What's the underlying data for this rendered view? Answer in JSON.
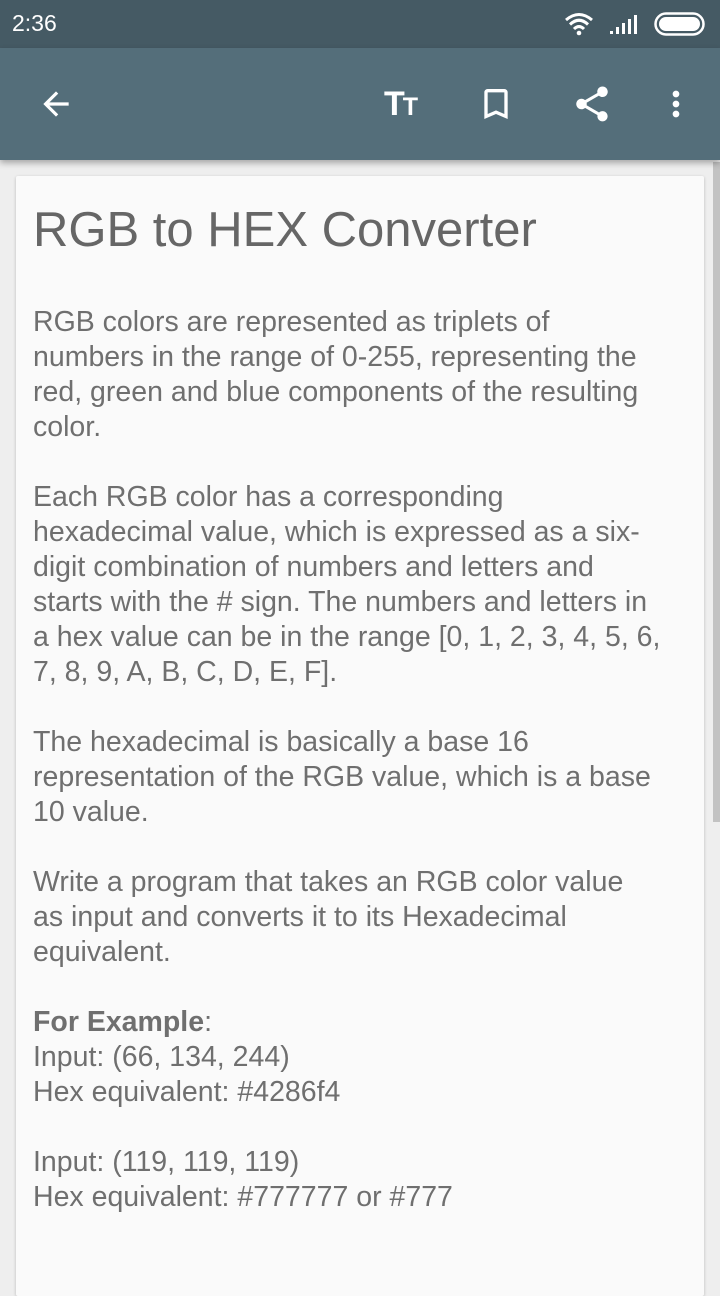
{
  "status_bar": {
    "time": "2:36"
  },
  "toolbar": {
    "icons": [
      "arrow-back-icon",
      "text-size-icon",
      "bookmark-icon",
      "share-icon",
      "more-vert-icon"
    ],
    "text_size_glyph_big": "T",
    "text_size_glyph_small": "T"
  },
  "article": {
    "title": "RGB to HEX Converter",
    "p1": [
      "RGB colors are represented as triplets of",
      "numbers in the range of 0-255, representing the",
      "red, green and blue components of the resulting",
      "color."
    ],
    "p2": [
      "Each RGB color has a corresponding",
      "hexadecimal value, which is expressed as a six-",
      "digit combination of numbers and letters and",
      "starts with the # sign. The numbers and letters in",
      "a hex value can be in the range [0, 1, 2, 3, 4, 5, 6,",
      "7, 8, 9, A, B, C, D, E, F]."
    ],
    "p3": [
      "The hexadecimal is basically a base 16",
      "representation of the RGB value, which is a base",
      "10 value."
    ],
    "p4": [
      "Write a program that takes an RGB color value",
      "as input and converts it to its Hexadecimal",
      "equivalent."
    ],
    "example_label": "For Example",
    "example_colon": ":",
    "example1_input": "Input: (66, 134, 244)",
    "example1_hex": "Hex equivalent: #4286f4",
    "example2_input": "Input: (119, 119, 119)",
    "example2_hex": "Hex equivalent: #777777 or #777"
  },
  "colors": {
    "status_bar": "#455a64",
    "toolbar": "#546e7a",
    "card": "#fafafa",
    "text": "#6f6f6f"
  }
}
